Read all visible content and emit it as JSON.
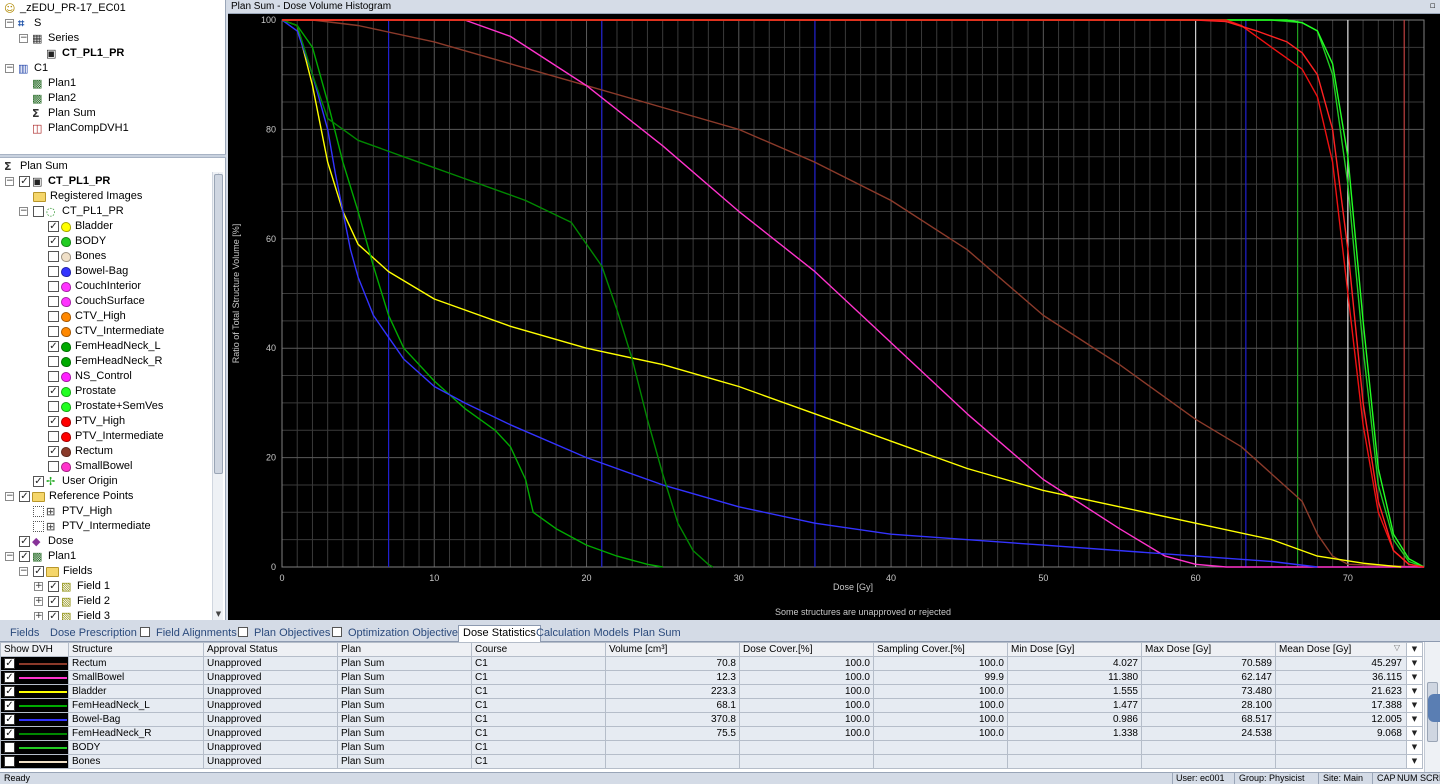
{
  "patient_tree": [
    {
      "label": "_zEDU_PR-17_EC01",
      "icon": "patient-icon",
      "indent": 0,
      "bold": false
    },
    {
      "label": "S",
      "icon": "study-icon",
      "indent": 1,
      "bold": false
    },
    {
      "label": "Series",
      "icon": "series-icon",
      "indent": 2,
      "bold": false
    },
    {
      "label": "CT_PL1_PR",
      "icon": "image-icon",
      "indent": 3,
      "bold": true
    },
    {
      "label": "C1",
      "icon": "course-icon",
      "indent": 1,
      "bold": false
    },
    {
      "label": "Plan1",
      "icon": "plan-icon",
      "indent": 2,
      "bold": false
    },
    {
      "label": "Plan2",
      "icon": "plan-icon",
      "indent": 2,
      "bold": false
    },
    {
      "label": "Plan Sum",
      "icon": "plan-sum-icon",
      "indent": 2,
      "bold": false
    },
    {
      "label": "PlanCompDVH1",
      "icon": "dvh-plan-icon",
      "indent": 2,
      "bold": false
    }
  ],
  "structure_tree": {
    "header": "Plan Sum",
    "image": "CT_PL1_PR",
    "registered_images": "Registered Images",
    "structure_set": "CT_PL1_PR",
    "structures": [
      {
        "name": "Bladder",
        "checked": true,
        "color": "#ffff00"
      },
      {
        "name": "BODY",
        "checked": true,
        "color": "#22cc22"
      },
      {
        "name": "Bones",
        "checked": false,
        "color": "#f0e0c8"
      },
      {
        "name": "Bowel-Bag",
        "checked": false,
        "color": "#3333ff"
      },
      {
        "name": "CouchInterior",
        "checked": false,
        "color": "#ff33ff"
      },
      {
        "name": "CouchSurface",
        "checked": false,
        "color": "#ff33ff"
      },
      {
        "name": "CTV_High",
        "checked": false,
        "color": "#ff8800"
      },
      {
        "name": "CTV_Intermediate",
        "checked": false,
        "color": "#ff8800"
      },
      {
        "name": "FemHeadNeck_L",
        "checked": true,
        "color": "#00aa00"
      },
      {
        "name": "FemHeadNeck_R",
        "checked": false,
        "color": "#00aa00"
      },
      {
        "name": "NS_Control",
        "checked": false,
        "color": "#ff22ff"
      },
      {
        "name": "Prostate",
        "checked": true,
        "color": "#22ff22"
      },
      {
        "name": "Prostate+SemVes",
        "checked": false,
        "color": "#22ff22"
      },
      {
        "name": "PTV_High",
        "checked": true,
        "color": "#ff0000"
      },
      {
        "name": "PTV_Intermediate",
        "checked": false,
        "color": "#ff0000"
      },
      {
        "name": "Rectum",
        "checked": true,
        "color": "#8a3a2a"
      },
      {
        "name": "SmallBowel",
        "checked": false,
        "color": "#ff33cc"
      }
    ],
    "user_origin": "User Origin",
    "reference_points": "Reference Points",
    "ref_point_items": [
      "PTV_High",
      "PTV_Intermediate"
    ],
    "dose": "Dose",
    "plan": "Plan1",
    "fields": "Fields",
    "field_items": [
      "Field 1",
      "Field 2",
      "Field 3"
    ]
  },
  "dvh_window": {
    "title": "Plan Sum - Dose Volume Histogram",
    "warning": "Some structures are unapproved or rejected",
    "pin_icon": "pin-icon"
  },
  "chart_data": {
    "type": "line",
    "title": "",
    "xlabel": "Dose [Gy]",
    "ylabel": "Ratio of Total Structure Volume [%]",
    "xlim": [
      0,
      75
    ],
    "ylim": [
      0,
      100
    ],
    "xticks": [
      0,
      10,
      20,
      30,
      40,
      50,
      60,
      70
    ],
    "yticks": [
      0,
      20,
      40,
      60,
      80,
      100
    ],
    "grid": true,
    "vertical_markers": [
      {
        "x": 7.0,
        "color": "#2020d0"
      },
      {
        "x": 21.0,
        "color": "#2020d0"
      },
      {
        "x": 35.0,
        "color": "#2020d0"
      },
      {
        "x": 60.0,
        "color": "#cccccc"
      },
      {
        "x": 63.3,
        "color": "#2020d0"
      },
      {
        "x": 66.7,
        "color": "#20a020"
      },
      {
        "x": 70.0,
        "color": "#e0e0e0"
      },
      {
        "x": 73.7,
        "color": "#c04040"
      }
    ],
    "series": [
      {
        "color": "#8b3a2a",
        "points": [
          [
            0,
            100
          ],
          [
            2,
            100
          ],
          [
            5,
            99
          ],
          [
            10,
            96
          ],
          [
            15,
            92
          ],
          [
            20,
            88
          ],
          [
            25,
            84
          ],
          [
            30,
            80
          ],
          [
            35,
            74
          ],
          [
            40,
            67
          ],
          [
            45,
            58
          ],
          [
            50,
            46
          ],
          [
            55,
            37
          ],
          [
            60,
            27
          ],
          [
            63,
            22
          ],
          [
            65,
            17
          ],
          [
            67,
            12
          ],
          [
            68,
            6
          ],
          [
            69,
            2
          ],
          [
            70,
            0.5
          ],
          [
            75,
            0
          ]
        ]
      },
      {
        "color": "#ff33cc",
        "points": [
          [
            0,
            100
          ],
          [
            10,
            100
          ],
          [
            12,
            100
          ],
          [
            15,
            97
          ],
          [
            20,
            88
          ],
          [
            25,
            77
          ],
          [
            30,
            65
          ],
          [
            35,
            54
          ],
          [
            40,
            41
          ],
          [
            45,
            28
          ],
          [
            50,
            16
          ],
          [
            55,
            7
          ],
          [
            58,
            2
          ],
          [
            60,
            0.5
          ],
          [
            62,
            0
          ],
          [
            75,
            0
          ]
        ]
      },
      {
        "color": "#ffff00",
        "points": [
          [
            0,
            100
          ],
          [
            1,
            99
          ],
          [
            2,
            88
          ],
          [
            3,
            74
          ],
          [
            4,
            65
          ],
          [
            5,
            59
          ],
          [
            7,
            54
          ],
          [
            10,
            49
          ],
          [
            15,
            44
          ],
          [
            20,
            40
          ],
          [
            25,
            37
          ],
          [
            30,
            33
          ],
          [
            35,
            28
          ],
          [
            40,
            23
          ],
          [
            45,
            18
          ],
          [
            50,
            14
          ],
          [
            55,
            11
          ],
          [
            60,
            8
          ],
          [
            65,
            5
          ],
          [
            68,
            2
          ],
          [
            71,
            0.7
          ],
          [
            73.5,
            0
          ]
        ]
      },
      {
        "color": "#00aa00",
        "points": [
          [
            0,
            100
          ],
          [
            1,
            99
          ],
          [
            2,
            95
          ],
          [
            3,
            85
          ],
          [
            4,
            74
          ],
          [
            5,
            65
          ],
          [
            6,
            55
          ],
          [
            7,
            46
          ],
          [
            8,
            40
          ],
          [
            10,
            34
          ],
          [
            12,
            29
          ],
          [
            14,
            25
          ],
          [
            15,
            22
          ],
          [
            16,
            16
          ],
          [
            16.5,
            10
          ],
          [
            18,
            7
          ],
          [
            20,
            4
          ],
          [
            22,
            2
          ],
          [
            24,
            0.5
          ],
          [
            25,
            0
          ]
        ]
      },
      {
        "color": "#3333ff",
        "points": [
          [
            0,
            100
          ],
          [
            1,
            98
          ],
          [
            2,
            90
          ],
          [
            3,
            80
          ],
          [
            3.5,
            72
          ],
          [
            4,
            65
          ],
          [
            4.5,
            58
          ],
          [
            5,
            53
          ],
          [
            6,
            46
          ],
          [
            7,
            42
          ],
          [
            8,
            38
          ],
          [
            10,
            33
          ],
          [
            12,
            30
          ],
          [
            15,
            26
          ],
          [
            20,
            20
          ],
          [
            25,
            15
          ],
          [
            30,
            11
          ],
          [
            35,
            8
          ],
          [
            40,
            6
          ],
          [
            50,
            4
          ],
          [
            60,
            2
          ],
          [
            65,
            1
          ],
          [
            68,
            0
          ]
        ]
      },
      {
        "color": "#008800",
        "points": [
          [
            0,
            100
          ],
          [
            1,
            99
          ],
          [
            2,
            90
          ],
          [
            3,
            82
          ],
          [
            5,
            78
          ],
          [
            8,
            75
          ],
          [
            12,
            71
          ],
          [
            16,
            67
          ],
          [
            19,
            63
          ],
          [
            21,
            55
          ],
          [
            22,
            47
          ],
          [
            23,
            38
          ],
          [
            24,
            27
          ],
          [
            25,
            17
          ],
          [
            26,
            8
          ],
          [
            27,
            3
          ],
          [
            28,
            0.5
          ],
          [
            28.3,
            0
          ]
        ]
      },
      {
        "color": "#22cc22",
        "points": [
          [
            0,
            100
          ],
          [
            65,
            100
          ],
          [
            67,
            99.5
          ],
          [
            68,
            98
          ],
          [
            69,
            90
          ],
          [
            70,
            70
          ],
          [
            71,
            40
          ],
          [
            72,
            15
          ],
          [
            73,
            5
          ],
          [
            74,
            1
          ],
          [
            75,
            0
          ]
        ]
      },
      {
        "color": "#22ff22",
        "points": [
          [
            0,
            100
          ],
          [
            66,
            100
          ],
          [
            67,
            99.5
          ],
          [
            68,
            98
          ],
          [
            69,
            92
          ],
          [
            70,
            75
          ],
          [
            71,
            45
          ],
          [
            72,
            18
          ],
          [
            73,
            6
          ],
          [
            74,
            1.5
          ],
          [
            75,
            0
          ]
        ]
      },
      {
        "color": "#ee1111",
        "points": [
          [
            0,
            100
          ],
          [
            62,
            100
          ],
          [
            63,
            99
          ],
          [
            64,
            97
          ],
          [
            65,
            95
          ],
          [
            66,
            93
          ],
          [
            67,
            91
          ],
          [
            68,
            86
          ],
          [
            69,
            74
          ],
          [
            70,
            50
          ],
          [
            71,
            26
          ],
          [
            72,
            10
          ],
          [
            73,
            3
          ],
          [
            74,
            0.5
          ],
          [
            75,
            0
          ]
        ]
      },
      {
        "color": "#ff2222",
        "points": [
          [
            0,
            100
          ],
          [
            60,
            100
          ],
          [
            62,
            99.7
          ],
          [
            64,
            98
          ],
          [
            66,
            96
          ],
          [
            67,
            94
          ],
          [
            68,
            90
          ],
          [
            69,
            80
          ],
          [
            70,
            58
          ],
          [
            71,
            30
          ],
          [
            72,
            12
          ],
          [
            73,
            3
          ],
          [
            74,
            0.5
          ],
          [
            75,
            0
          ]
        ]
      }
    ]
  },
  "tabs": [
    {
      "label": "Fields",
      "checkbox": false,
      "active": false
    },
    {
      "label": "Dose Prescription",
      "checkbox": false,
      "active": false
    },
    {
      "label": "Field Alignments",
      "checkbox": true,
      "active": false
    },
    {
      "label": "Plan Objectives",
      "checkbox": true,
      "active": false
    },
    {
      "label": "Optimization Objectives",
      "checkbox": true,
      "active": false
    },
    {
      "label": "Dose Statistics",
      "checkbox": false,
      "active": true
    },
    {
      "label": "Calculation Models",
      "checkbox": false,
      "active": false
    },
    {
      "label": "Plan Sum",
      "checkbox": false,
      "active": false
    }
  ],
  "dose_statistics": {
    "columns": [
      "Show DVH",
      "Structure",
      "Approval Status",
      "Plan",
      "Course",
      "Volume [cm³]",
      "Dose Cover.[%]",
      "Sampling Cover.[%]",
      "Min Dose [Gy]",
      "Max Dose [Gy]",
      "Mean Dose [Gy]"
    ],
    "sort_icon": "sort-triangle-icon",
    "rows": [
      {
        "show": true,
        "color": "#8b3a2a",
        "structure": "Rectum",
        "approval": "Unapproved",
        "plan": "Plan Sum",
        "course": "C1",
        "volume": "70.8",
        "dose_cover": "100.0",
        "sampling_cover": "100.0",
        "min": "4.027",
        "max": "70.589",
        "mean": "45.297"
      },
      {
        "show": true,
        "color": "#ff33cc",
        "structure": "SmallBowel",
        "approval": "Unapproved",
        "plan": "Plan Sum",
        "course": "C1",
        "volume": "12.3",
        "dose_cover": "100.0",
        "sampling_cover": "99.9",
        "min": "11.380",
        "max": "62.147",
        "mean": "36.115"
      },
      {
        "show": true,
        "color": "#ffff00",
        "structure": "Bladder",
        "approval": "Unapproved",
        "plan": "Plan Sum",
        "course": "C1",
        "volume": "223.3",
        "dose_cover": "100.0",
        "sampling_cover": "100.0",
        "min": "1.555",
        "max": "73.480",
        "mean": "21.623"
      },
      {
        "show": true,
        "color": "#00aa00",
        "structure": "FemHeadNeck_L",
        "approval": "Unapproved",
        "plan": "Plan Sum",
        "course": "C1",
        "volume": "68.1",
        "dose_cover": "100.0",
        "sampling_cover": "100.0",
        "min": "1.477",
        "max": "28.100",
        "mean": "17.388"
      },
      {
        "show": true,
        "color": "#3333ff",
        "structure": "Bowel-Bag",
        "approval": "Unapproved",
        "plan": "Plan Sum",
        "course": "C1",
        "volume": "370.8",
        "dose_cover": "100.0",
        "sampling_cover": "100.0",
        "min": "0.986",
        "max": "68.517",
        "mean": "12.005"
      },
      {
        "show": true,
        "color": "#008800",
        "structure": "FemHeadNeck_R",
        "approval": "Unapproved",
        "plan": "Plan Sum",
        "course": "C1",
        "volume": "75.5",
        "dose_cover": "100.0",
        "sampling_cover": "100.0",
        "min": "1.338",
        "max": "24.538",
        "mean": "9.068"
      },
      {
        "show": false,
        "color": "#22cc22",
        "structure": "BODY",
        "approval": "Unapproved",
        "plan": "Plan Sum",
        "course": "C1",
        "volume": "",
        "dose_cover": "",
        "sampling_cover": "",
        "min": "",
        "max": "",
        "mean": ""
      },
      {
        "show": false,
        "color": "#f0e0c8",
        "structure": "Bones",
        "approval": "Unapproved",
        "plan": "Plan Sum",
        "course": "C1",
        "volume": "",
        "dose_cover": "",
        "sampling_cover": "",
        "min": "",
        "max": "",
        "mean": ""
      }
    ]
  },
  "status_bar": {
    "left": "Ready",
    "user": "User: ec001",
    "group": "Group: Physicist",
    "site": "Site: Main",
    "cap": "CAP",
    "num": "NUM",
    "scrl": "SCRL"
  }
}
